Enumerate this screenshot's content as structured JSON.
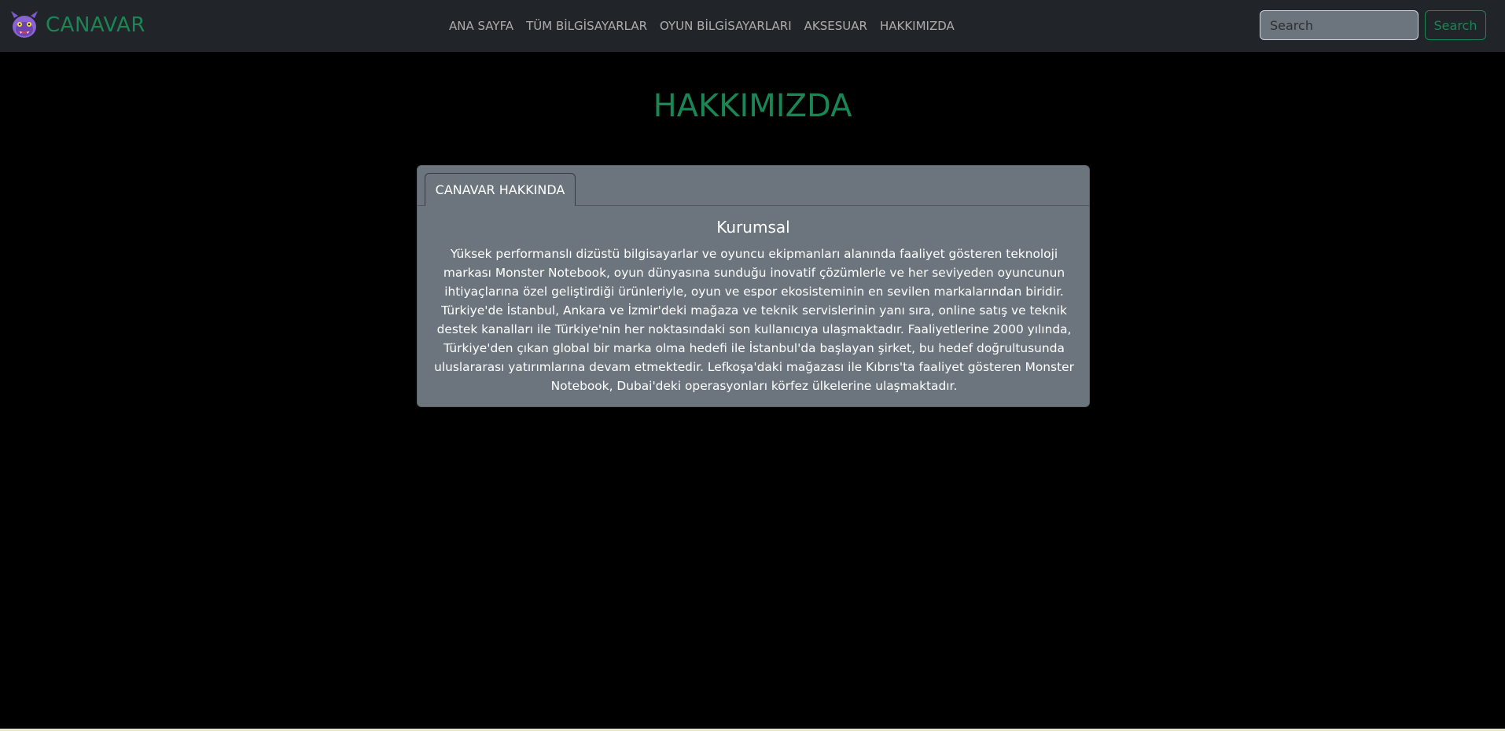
{
  "brand": {
    "name": "CANAVAR",
    "logo_icon": "monster-logo-icon"
  },
  "nav": {
    "items": [
      {
        "label": "ANA SAYFA"
      },
      {
        "label": "TÜM BİLGİSAYARLAR"
      },
      {
        "label": "OYUN BİLGİSAYARLARI"
      },
      {
        "label": "AKSESUAR"
      },
      {
        "label": "HAKKIMIZDA"
      }
    ]
  },
  "search": {
    "placeholder": "Search",
    "button_label": "Search"
  },
  "page": {
    "title": "HAKKIMIZDA"
  },
  "card": {
    "tab_label": "CANAVAR HAKKINDA",
    "title": "Kurumsal",
    "text": "Yüksek performanslı dizüstü bilgisayarlar ve oyuncu ekipmanları alanında faaliyet gösteren teknoloji markası Monster Notebook, oyun dünyasına sunduğu inovatif çözümlerle ve her seviyeden oyuncunun ihtiyaçlarına özel geliştirdiği ürünleriyle, oyun ve espor ekosisteminin en sevilen markalarından biridir. Türkiye'de İstanbul, Ankara ve İzmir'deki mağaza ve teknik servislerinin yanı sıra, online satış ve teknik destek kanalları ile Türkiye'nin her noktasındaki son kullanıcıya ulaşmaktadır. Faaliyetlerine 2000 yılında, Türkiye'den çıkan global bir marka olma hedefi ile İstanbul'da başlayan şirket, bu hedef doğrultusunda uluslararası yatırımlarına devam etmektedir. Lefkoşa'daki mağazası ile Kıbrıs'ta faaliyet gösteren Monster Notebook, Dubai'deki operasyonları körfez ülkelerine ulaşmaktadır."
  },
  "colors": {
    "navbar_bg": "#212529",
    "accent": "#198754",
    "card_bg": "#6c757d",
    "page_bg": "#000000"
  }
}
